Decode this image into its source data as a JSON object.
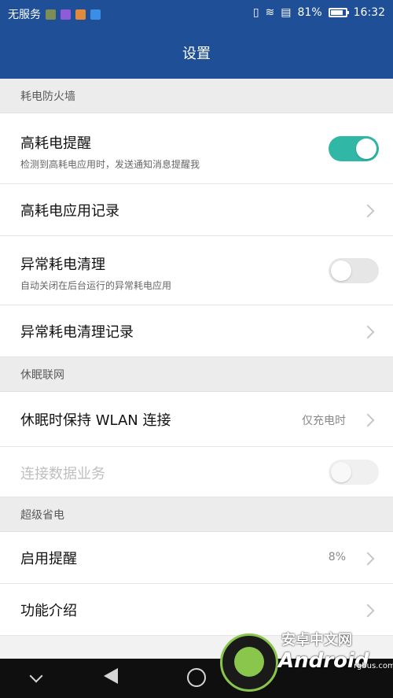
{
  "status_bar": {
    "carrier": "无服务",
    "battery_percent": "81%",
    "battery_level": 0.81,
    "time": "16:32",
    "notification_colors": [
      "#7c8d55",
      "#8f5bd7",
      "#e08a3d",
      "#3a8ee6"
    ]
  },
  "app_bar": {
    "title": "设置"
  },
  "sections": [
    {
      "header": "耗电防火墙",
      "rows": [
        {
          "title": "高耗电提醒",
          "subtitle": "检测到高耗电应用时，发送通知消息提醒我",
          "control": "toggle",
          "on": true
        },
        {
          "title": "高耗电应用记录",
          "control": "chevron"
        },
        {
          "title": "异常耗电清理",
          "subtitle": "自动关闭在后台运行的异常耗电应用",
          "control": "toggle",
          "on": false
        },
        {
          "title": "异常耗电清理记录",
          "control": "chevron"
        }
      ]
    },
    {
      "header": "休眠联网",
      "rows": [
        {
          "title": "休眠时保持 WLAN 连接",
          "value": "仅充电时",
          "control": "chevron"
        },
        {
          "title": "连接数据业务",
          "control": "toggle",
          "on": false,
          "disabled": true
        }
      ]
    },
    {
      "header": "超级省电",
      "rows": [
        {
          "title": "启用提醒",
          "value": "8%",
          "control": "chevron"
        },
        {
          "title": "功能介绍",
          "control": "chevron"
        }
      ]
    }
  ],
  "watermark": {
    "line1": "安卓中文网",
    "line2": "Android",
    "line3": "rgbus.com"
  },
  "colors": {
    "primary": "#1f4f97",
    "toggle_on": "#30b7a5"
  }
}
